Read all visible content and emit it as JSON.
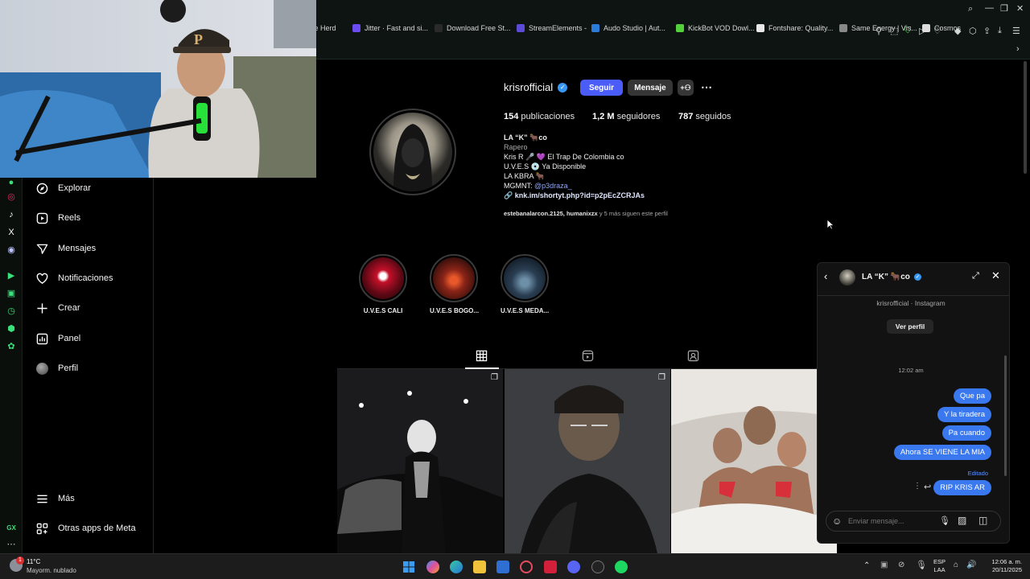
{
  "browser": {
    "bookmarks": [
      {
        "label": "ive Herd",
        "color": "#d04a2a"
      },
      {
        "label": "Jitter · Fast and si...",
        "color": "#6a4cf0"
      },
      {
        "label": "Download Free St...",
        "color": "#2a2a2a"
      },
      {
        "label": "StreamElements -",
        "color": "#5b4bd6"
      },
      {
        "label": "Audo Studio | Aut...",
        "color": "#2d7bd8"
      },
      {
        "label": "KickBot VOD Dowl...",
        "color": "#53d13c"
      },
      {
        "label": "Fontshare: Quality...",
        "color": "#e8e8e8"
      },
      {
        "label": "Same Energy | Vis...",
        "color": "#888888"
      },
      {
        "label": "Cosmos",
        "color": "#dddddd"
      }
    ]
  },
  "nav": {
    "items": [
      {
        "label": "Explorar",
        "icon": "compass-icon"
      },
      {
        "label": "Reels",
        "icon": "reels-icon"
      },
      {
        "label": "Mensajes",
        "icon": "messages-icon"
      },
      {
        "label": "Notificaciones",
        "icon": "heart-icon"
      },
      {
        "label": "Crear",
        "icon": "plus-icon"
      },
      {
        "label": "Panel",
        "icon": "dashboard-icon"
      },
      {
        "label": "Perfil",
        "icon": "avatar-icon"
      }
    ],
    "more": "Más",
    "meta_apps": "Otras apps de Meta"
  },
  "profile": {
    "username": "krisrofficial",
    "follow_btn": "Seguir",
    "message_btn": "Mensaje",
    "posts_count": "154",
    "posts_label": "publicaciones",
    "followers_count": "1,2 M",
    "followers_label": "seguidores",
    "following_count": "787",
    "following_label": "seguidos",
    "display_name": "LA “K” 🐂co",
    "category": "Rapero",
    "bio_lines": [
      "Kris R 🎤 💜 El Trap De Colombia co",
      "U.V.E.S 💿 Ya Disponible",
      "LA KBRA 🐂"
    ],
    "mgmt_label": "MGMNT:",
    "mgmt_handle": "@p3draza_",
    "link": "knk.im/shortyt.php?id=p2pEcZCRJAs",
    "followed_by_names": "estebanalarcon.2125, humanixzx",
    "followed_by_rest": "y 5 más siguen este perfil"
  },
  "highlights": [
    {
      "label": "U.V.E.S CALI"
    },
    {
      "label": "U.V.E.S BOGO..."
    },
    {
      "label": "U.V.E.S MEDA..."
    }
  ],
  "dm": {
    "title": "LA “K” 🐂co",
    "subtitle": "krisrofficial · Instagram",
    "view_profile": "Ver perfil",
    "timestamp": "12:02 am",
    "messages": [
      "Que pa",
      "Y la tiradera",
      "Pa cuando",
      "Ahora SE VIENE LA MIA"
    ],
    "edited_label": "Editado",
    "last_message": "RIP KRIS AR",
    "input_placeholder": "Enviar mensaje..."
  },
  "taskbar": {
    "weather_temp": "11°C",
    "weather_desc": "Mayorm. nublado",
    "weather_badge": "1",
    "lang_top": "ESP",
    "lang_bottom": "LAA",
    "time": "12:06 a. m.",
    "date": "20/11/2025"
  },
  "colors": {
    "accent": "#4a5df9",
    "bubble": "#3a78f0",
    "verified": "#3897f0"
  }
}
